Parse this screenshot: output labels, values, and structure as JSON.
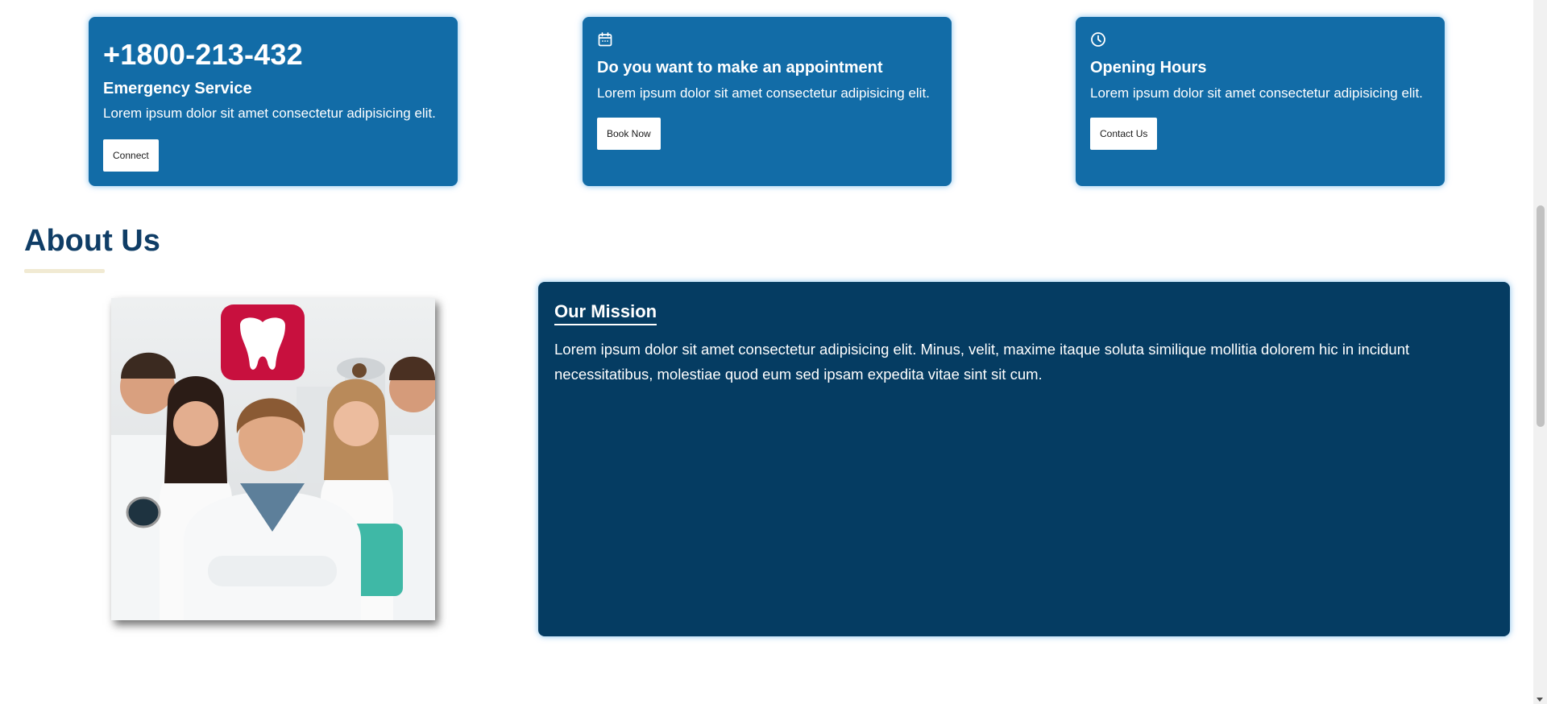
{
  "cards": [
    {
      "phone": "+1800-213-432",
      "title": "Emergency Service",
      "text": "Lorem ipsum dolor sit amet consectetur adipisicing elit.",
      "button": "Connect"
    },
    {
      "icon": "calendar-icon",
      "title": "Do you want to make an appointment",
      "text": "Lorem ipsum dolor sit amet consectetur adipisicing elit.",
      "button": "Book Now"
    },
    {
      "icon": "clock-icon",
      "title": "Opening Hours",
      "text": "Lorem ipsum dolor sit amet consectetur adipisicing elit.",
      "button": "Contact Us"
    }
  ],
  "about": {
    "heading": "About Us",
    "mission_title": "Our Mission",
    "mission_text": "Lorem ipsum dolor sit amet consectetur adipisicing elit. Minus, velit, maxime itaque soluta similique mollitia dolorem hic in incidunt necessitatibus, molestiae quod eum sed ipsam expedita vitae sint sit cum."
  },
  "colors": {
    "card_bg": "#126ca7",
    "mission_bg": "#053c62",
    "heading": "#0f3d66",
    "accent_underline": "#f1ead3",
    "brand_tooth": "#c8103e"
  }
}
